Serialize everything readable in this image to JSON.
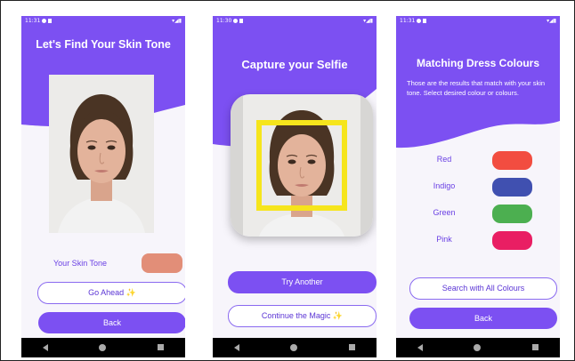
{
  "status_times": [
    "11:31",
    "11:30",
    "11:31"
  ],
  "screen1": {
    "title": "Let's Find Your Skin Tone",
    "skin_tone_label": "Your Skin Tone",
    "skin_tone_color": "#e28e78",
    "go_ahead_label": "Go Ahead ✨",
    "back_label": "Back"
  },
  "screen2": {
    "title": "Capture your Selfie",
    "try_another_label": "Try Another",
    "continue_label": "Continue the Magic ✨",
    "face_box_color": "#f6e51c"
  },
  "screen3": {
    "title": "Matching Dress Colours",
    "subtitle": "Those are the results that match with your skin tone. Select desired colour or colours.",
    "colours": [
      {
        "name": "Red",
        "hex": "#f24d40"
      },
      {
        "name": "Indigo",
        "hex": "#4050b0"
      },
      {
        "name": "Green",
        "hex": "#4caf50"
      },
      {
        "name": "Pink",
        "hex": "#e91e63"
      }
    ],
    "search_all_label": "Search with All Colours",
    "back_label": "Back"
  },
  "theme": {
    "accent": "#7c50f2",
    "background": "#f7f5fb"
  }
}
